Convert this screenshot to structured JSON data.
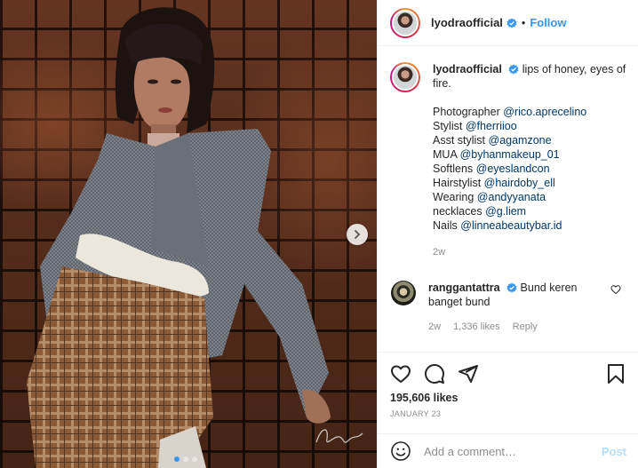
{
  "post": {
    "username": "lyodraofficial",
    "follow_label": "Follow",
    "separator": "•",
    "slide_count": 3,
    "active_slide": 1
  },
  "caption": {
    "username": "lyodraofficial",
    "text": "lips of honey, eyes of fire.",
    "credits": [
      {
        "label": "Photographer ",
        "mention": "@rico.aprecelino"
      },
      {
        "label": "Stylist ",
        "mention": "@fherriioo"
      },
      {
        "label": "Asst stylist ",
        "mention": "@agamzone"
      },
      {
        "label": "MUA ",
        "mention": "@byhanmakeup_01"
      },
      {
        "label": "Softlens ",
        "mention": "@eyeslandcon"
      },
      {
        "label": "Hairstylist ",
        "mention": "@hairdoby_ell"
      },
      {
        "label": "Wearing ",
        "mention": "@andyyanata"
      },
      {
        "label": "necklaces ",
        "mention": "@g.liem"
      },
      {
        "label": "Nails ",
        "mention": "@linneabeautybar.id"
      }
    ],
    "time": "2w"
  },
  "comment": {
    "username": "ranggantattra",
    "text": "Bund keren banget bund",
    "time": "2w",
    "likes": "1,336 likes",
    "reply_label": "Reply"
  },
  "engagement": {
    "likes": "195,606 likes",
    "date": "JANUARY 23"
  },
  "add_comment": {
    "placeholder": "Add a comment…",
    "post_label": "Post"
  },
  "colors": {
    "link": "#3897f0",
    "mention": "#00376b",
    "muted": "#8e8e8e",
    "post_disabled": "#b2dffc"
  }
}
